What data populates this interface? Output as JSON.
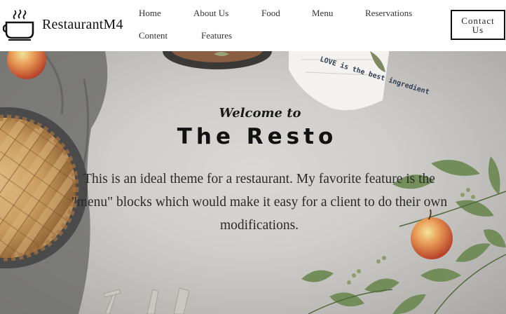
{
  "brand": {
    "name": "RestaurantM4",
    "logo_icon": "food-bowl-icon"
  },
  "nav": {
    "items": [
      {
        "label": "Home"
      },
      {
        "label": "About Us"
      },
      {
        "label": "Food"
      },
      {
        "label": "Menu"
      },
      {
        "label": "Reservations"
      },
      {
        "label": "Content"
      },
      {
        "label": "Features"
      }
    ],
    "contact_label": "Contact Us"
  },
  "hero": {
    "welcome": "Welcome to",
    "title": "The Resto",
    "description": "This is an ideal theme for a restaurant. My favorite feature is the \"menu\" blocks which would make it easy for a client to do their own modifications.",
    "napkin_text": "LOVE is the best ingredient"
  },
  "colors": {
    "accent": "#111111",
    "background": "#cfcecb"
  }
}
